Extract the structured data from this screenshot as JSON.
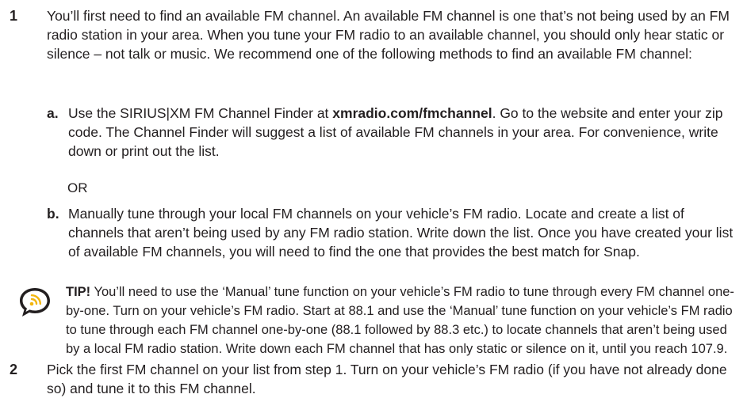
{
  "step1": {
    "number": "1",
    "text": "You’ll first need to find an available FM channel. An available FM channel is one that’s not being used by an FM radio station in your area. When you tune your FM radio to an available channel, you should only hear static or silence – not talk or music. We recommend one of the following methods to find an available FM channel:"
  },
  "option_a": {
    "letter": "a.",
    "text_before": "Use the SIRIUS|XM FM Channel Finder at ",
    "link": "xmradio.com/fmchannel",
    "text_after": ". Go to the website and enter your zip code. The Channel Finder will suggest a list of available FM channels in your area. For convenience, write down or print out the list."
  },
  "or_text": "OR",
  "option_b": {
    "letter": "b.",
    "text": "Manually tune through your local FM channels on your vehicle’s FM radio. Locate and create a list of channels that aren’t being used by any FM radio station. Write down the list. Once you have created your list of available FM channels, you will need to find the one that provides the best match for Snap."
  },
  "tip": {
    "icon": "speech-bubble-signal-icon",
    "label": "TIP!",
    "text": " You’ll need to use the ‘Manual’ tune function on your vehicle’s FM radio to tune through every FM channel one-by-one. Turn on your vehicle’s FM radio. Start at 88.1 and use the ‘Manual’ tune function on your vehicle’s FM radio to tune through each FM channel one-by-one (88.1 followed by 88.3 etc.) to locate channels that aren’t being used by a local FM radio station. Write down each FM channel that has only static or silence on it, until you reach 107.9."
  },
  "step2": {
    "number": "2",
    "text": "Pick the first FM channel on your list from step 1. Turn on your vehicle’s FM radio (if you have not already done so) and tune it to this FM channel."
  }
}
